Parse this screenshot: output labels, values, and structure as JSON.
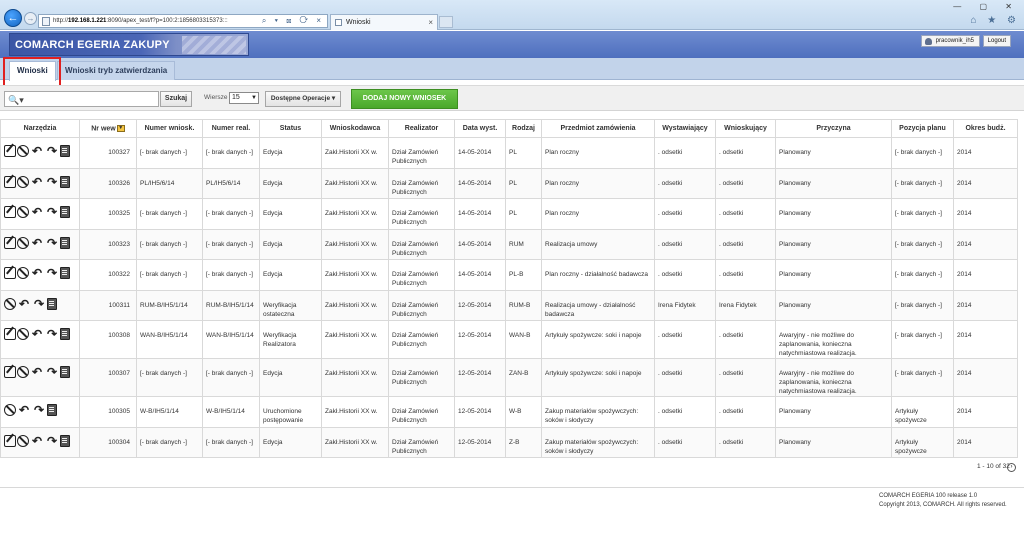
{
  "browser": {
    "url_host": "192.168.1.221",
    "url_prefix": "http://",
    "url_rest": ":8090/apex_test/f?p=100:2:1856803315373:::",
    "tab_title": "Wnioski",
    "back_glyph": "←",
    "fwd_glyph": "→",
    "close_glyph": "×",
    "addr_tools": "⌕ ▾ ⊠ ⟳ ×",
    "window_controls": "— ▢ ✕",
    "toolbar_icons": "⌂ ★ ⚙"
  },
  "header": {
    "logo_text": "COMARCH EGERIA ZAKUPY",
    "user": "pracownik_ih5",
    "logout": "Logout"
  },
  "tabs": [
    {
      "label": "Wnioski"
    },
    {
      "label": "Wnioski tryb zatwierdzania"
    }
  ],
  "toolbar": {
    "search_icon": "🔍▾",
    "search_placeholder": "",
    "search_button": "Szukaj",
    "rows_label": "Wiersze",
    "rows_value": "15",
    "operations": "Dostępne Operacje",
    "operations_arrow": "▾",
    "add_button": "DODAJ NOWY WNIOSEK"
  },
  "table": {
    "headers": [
      "Narzędzia",
      "Nr wew",
      "Numer wniosk.",
      "Numer real.",
      "Status",
      "Wnioskodawca",
      "Realizator",
      "Data wyst.",
      "Rodzaj",
      "Przedmiot zamówienia",
      "Wystawiający",
      "Wnioskujący",
      "Przyczyna",
      "Pozycja planu",
      "Okres budż."
    ],
    "sort_glyph": "▼",
    "rows": [
      {
        "edit": true,
        "nr": "100327",
        "numer": "[- brak danych -]",
        "real": "[- brak danych -]",
        "status": "Edycja",
        "wnioskodawca": "Zakł.Historii XX w.",
        "realizator": "Dział Zamówień Publicznych",
        "data": "14-05-2014",
        "rodzaj": "PL",
        "przedmiot": "Plan roczny",
        "wystawiajacy": ". odsetki",
        "wnioskujacy": ". odsetki",
        "przyczyna": "Planowany",
        "pozycja": "[- brak danych -]",
        "okres": "2014"
      },
      {
        "edit": true,
        "nr": "100326",
        "numer": "PL/IH5/6/14",
        "real": "PL/IH5/6/14",
        "status": "Edycja",
        "wnioskodawca": "Zakł.Historii XX w.",
        "realizator": "Dział Zamówień Publicznych",
        "data": "14-05-2014",
        "rodzaj": "PL",
        "przedmiot": "Plan roczny",
        "wystawiajacy": ". odsetki",
        "wnioskujacy": ". odsetki",
        "przyczyna": "Planowany",
        "pozycja": "[- brak danych -]",
        "okres": "2014"
      },
      {
        "edit": true,
        "nr": "100325",
        "numer": "[- brak danych -]",
        "real": "[- brak danych -]",
        "status": "Edycja",
        "wnioskodawca": "Zakł.Historii XX w.",
        "realizator": "Dział Zamówień Publicznych",
        "data": "14-05-2014",
        "rodzaj": "PL",
        "przedmiot": "Plan roczny",
        "wystawiajacy": ". odsetki",
        "wnioskujacy": ". odsetki",
        "przyczyna": "Planowany",
        "pozycja": "[- brak danych -]",
        "okres": "2014"
      },
      {
        "edit": true,
        "nr": "100323",
        "numer": "[- brak danych -]",
        "real": "[- brak danych -]",
        "status": "Edycja",
        "wnioskodawca": "Zakł.Historii XX w.",
        "realizator": "Dział Zamówień Publicznych",
        "data": "14-05-2014",
        "rodzaj": "RUM",
        "przedmiot": "Realizacja umowy",
        "wystawiajacy": ". odsetki",
        "wnioskujacy": ". odsetki",
        "przyczyna": "Planowany",
        "pozycja": "[- brak danych -]",
        "okres": "2014"
      },
      {
        "edit": true,
        "nr": "100322",
        "numer": "[- brak danych -]",
        "real": "[- brak danych -]",
        "status": "Edycja",
        "wnioskodawca": "Zakł.Historii XX w.",
        "realizator": "Dział Zamówień Publicznych",
        "data": "14-05-2014",
        "rodzaj": "PL-B",
        "przedmiot": "Plan roczny - działalność badawcza",
        "wystawiajacy": ". odsetki",
        "wnioskujacy": ". odsetki",
        "przyczyna": "Planowany",
        "pozycja": "[- brak danych -]",
        "okres": "2014"
      },
      {
        "edit": false,
        "nr": "100311",
        "numer": "RUM-B/IH5/1/14",
        "real": "RUM-B/IH5/1/14",
        "status": "Weryfikacja ostateczna",
        "wnioskodawca": "Zakł.Historii XX w.",
        "realizator": "Dział Zamówień Publicznych",
        "data": "12-05-2014",
        "rodzaj": "RUM-B",
        "przedmiot": "Realizacja umowy - działalność badawcza",
        "wystawiajacy": "Irena Fidytek",
        "wnioskujacy": "Irena Fidytek",
        "przyczyna": "Planowany",
        "pozycja": "[- brak danych -]",
        "okres": "2014"
      },
      {
        "edit": true,
        "nr": "100308",
        "numer": "WAN-B/IH5/1/14",
        "real": "WAN-B/IH5/1/14",
        "status": "Weryfikacja Realizatora",
        "wnioskodawca": "Zakł.Historii XX w.",
        "realizator": "Dział Zamówień Publicznych",
        "data": "12-05-2014",
        "rodzaj": "WAN-B",
        "przedmiot": "Artykuły spożywcze: soki i napoje",
        "wystawiajacy": ". odsetki",
        "wnioskujacy": ". odsetki",
        "przyczyna": "Awaryjny - nie możliwe do zaplanowania, konieczna natychmiastowa realizacja.",
        "pozycja": "[- brak danych -]",
        "okres": "2014"
      },
      {
        "edit": true,
        "nr": "100307",
        "numer": "[- brak danych -]",
        "real": "[- brak danych -]",
        "status": "Edycja",
        "wnioskodawca": "Zakł.Historii XX w.",
        "realizator": "Dział Zamówień Publicznych",
        "data": "12-05-2014",
        "rodzaj": "ZAN-B",
        "przedmiot": "Artykuły spożywcze: soki i napoje",
        "wystawiajacy": ". odsetki",
        "wnioskujacy": ". odsetki",
        "przyczyna": "Awaryjny - nie możliwe do zaplanowania, konieczna natychmiastowa realizacja.",
        "pozycja": "[- brak danych -]",
        "okres": "2014"
      },
      {
        "edit": false,
        "nr": "100305",
        "numer": "W-B/IH5/1/14",
        "real": "W-B/IH5/1/14",
        "status": "Uruchomione postępowanie",
        "wnioskodawca": "Zakł.Historii XX w.",
        "realizator": "Dział Zamówień Publicznych",
        "data": "12-05-2014",
        "rodzaj": "W-B",
        "przedmiot": "Zakup materiałów spożywczych: soków i słodyczy",
        "wystawiajacy": ". odsetki",
        "wnioskujacy": ". odsetki",
        "przyczyna": "Planowany",
        "pozycja": "Artykuły spożywcze",
        "okres": "2014"
      },
      {
        "edit": true,
        "nr": "100304",
        "numer": "[- brak danych -]",
        "real": "[- brak danych -]",
        "status": "Edycja",
        "wnioskodawca": "Zakł.Historii XX w.",
        "realizator": "Dział Zamówień Publicznych",
        "data": "12-05-2014",
        "rodzaj": "Z-B",
        "przedmiot": "Zakup materiałów spożywczych: soków i słodyczy",
        "wystawiajacy": ". odsetki",
        "wnioskujacy": ". odsetki",
        "przyczyna": "Planowany",
        "pozycja": "Artykuły spożywcze",
        "okres": "2014"
      }
    ]
  },
  "pager": {
    "text": "1 - 10 of 32",
    "next_glyph": "›"
  },
  "footer": {
    "release": "COMARCH EGERIA 100 release 1.0",
    "copyright": "Copyright 2013, COMARCH. All rights reserved."
  }
}
